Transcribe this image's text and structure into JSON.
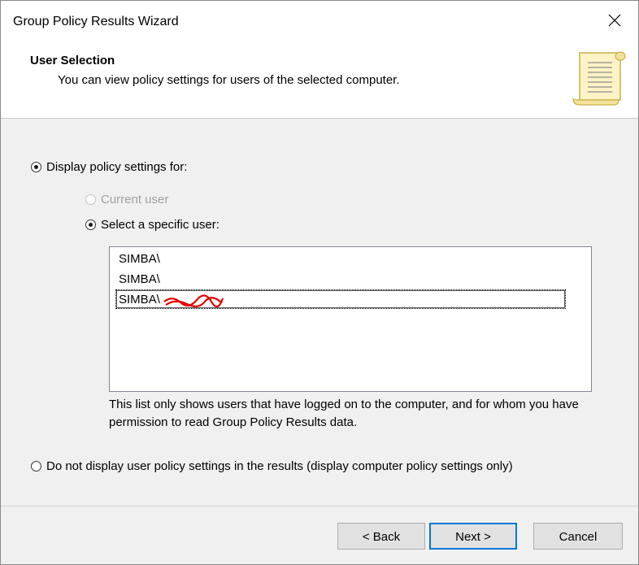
{
  "window": {
    "title": "Group Policy Results Wizard"
  },
  "header": {
    "title": "User Selection",
    "subtitle": "You can view policy settings for users of the selected computer."
  },
  "options": {
    "display_for_label": "Display policy settings for:",
    "current_user_label": "Current user",
    "specific_user_label": "Select a specific user:",
    "no_display_label": "Do not display user policy settings in the results (display computer policy settings only)"
  },
  "users": [
    {
      "prefix": "SIMBA\\",
      "selected": false
    },
    {
      "prefix": "SIMBA\\",
      "selected": false
    },
    {
      "prefix": "SIMBA\\",
      "selected": true
    }
  ],
  "note": "This list only shows users that have logged on to the computer, and for whom you have permission to read Group Policy Results data.",
  "buttons": {
    "back": "< Back",
    "next": "Next >",
    "cancel": "Cancel"
  },
  "colors": {
    "focus_border": "#0078d7",
    "redaction": "#e60000"
  }
}
